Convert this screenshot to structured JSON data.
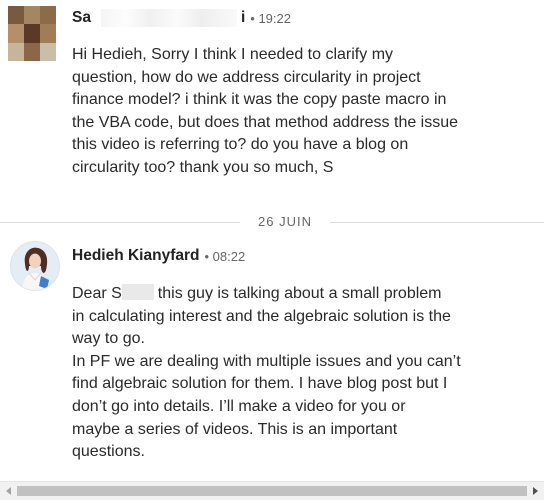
{
  "messages": [
    {
      "sender_prefix": "Sa",
      "sender_suffix": "i",
      "meta": "• 19:22",
      "body": "Hi Hedieh, Sorry I think I needed to clarify my\nquestion, how do we address circularity in project\nfinance model? i think it was the copy paste macro in\nthe VBA code, but does that method address the issue\nthis video is referring to? do you have a blog on\ncircularity too? thank you so much, S"
    },
    {
      "sender": "Hedieh Kianyfard",
      "meta": "• 08:22",
      "body_start": "Dear S",
      "body_rest": "this guy is talking about a small problem\nin calculating interest and the algebraic solution is the\nway to go.\nIn PF we are dealing with multiple issues and you can’t\nfind algebraic solution for them. I have blog post but I\ndon’t go into details. I’ll make a video for you or\nmaybe a series of videos. This is an important\nquestions."
    }
  ],
  "date_divider": "26 JUIN",
  "avatar_pixel_colors": [
    "#7a5a3e",
    "#a58562",
    "#8d6a49",
    "#b48f69",
    "#5a3a26",
    "#a07c58",
    "#c7b59b",
    "#8a6748",
    "#c9bfa9"
  ],
  "icons": {
    "scroll_left": "triangle-left",
    "scroll_right": "triangle-right"
  }
}
